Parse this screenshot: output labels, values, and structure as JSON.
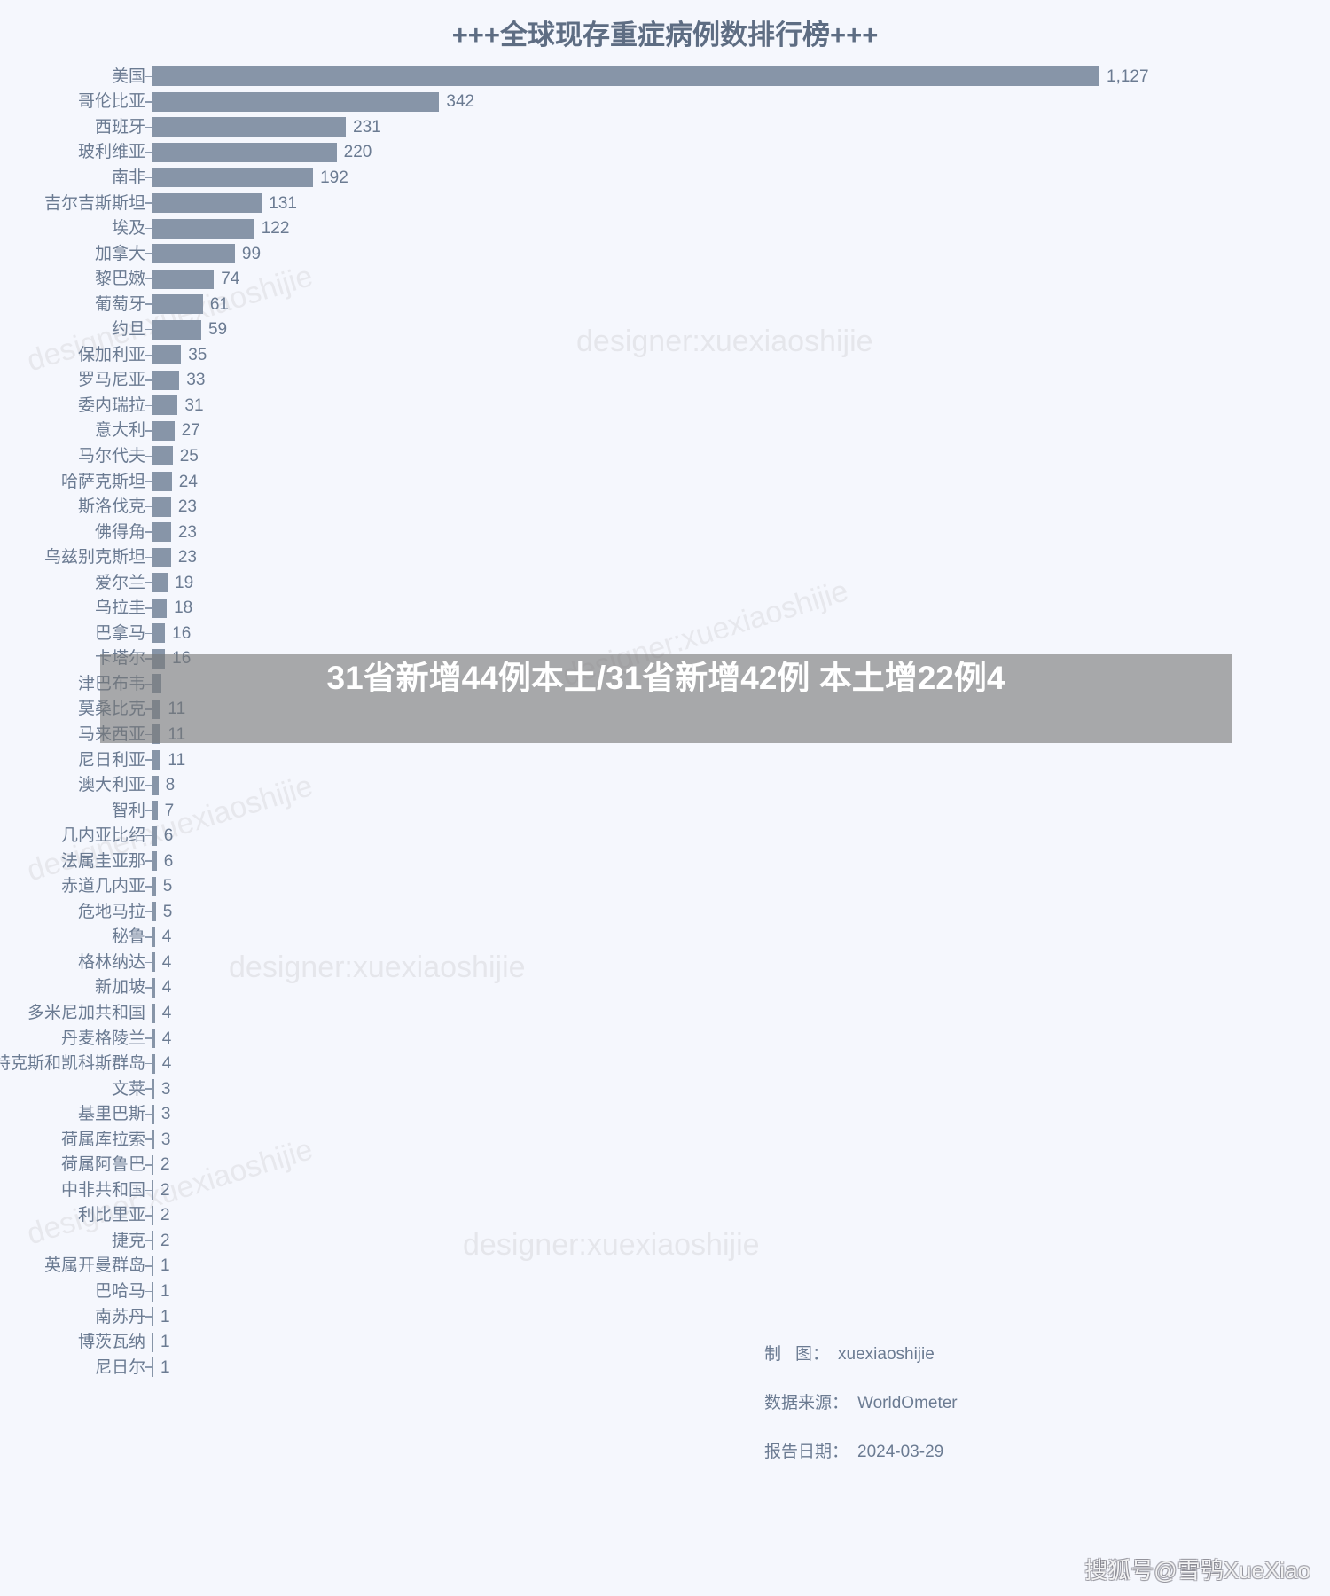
{
  "chart_data": {
    "type": "bar",
    "title": "+++全球现存重症病例数排行榜+++",
    "xlabel": "",
    "ylabel": "",
    "orientation": "horizontal",
    "grid": false,
    "legend": null,
    "xlim": [
      0,
      1127
    ],
    "bar_color": "#8795a8",
    "categories": [
      "美国",
      "哥伦比亚",
      "西班牙",
      "玻利维亚",
      "南非",
      "吉尔吉斯斯坦",
      "埃及",
      "加拿大",
      "黎巴嫩",
      "葡萄牙",
      "约旦",
      "保加利亚",
      "罗马尼亚",
      "委内瑞拉",
      "意大利",
      "马尔代夫",
      "哈萨克斯坦",
      "斯洛伐克",
      "佛得角",
      "乌兹别克斯坦",
      "爱尔兰",
      "乌拉圭",
      "巴拿马",
      "卡塔尔",
      "津巴布韦",
      "莫桑比克",
      "马来西亚",
      "尼日利亚",
      "澳大利亚",
      "智利",
      "几内亚比绍",
      "法属圭亚那",
      "赤道几内亚",
      "危地马拉",
      "秘鲁",
      "格林纳达",
      "新加坡",
      "多米尼加共和国",
      "丹麦格陵兰",
      "特克斯和凯科斯群岛",
      "文莱",
      "基里巴斯",
      "荷属库拉索",
      "荷属阿鲁巴",
      "中非共和国",
      "利比里亚",
      "捷克",
      "英属开曼群岛",
      "巴哈马",
      "南苏丹",
      "博茨瓦纳",
      "尼日尔"
    ],
    "values": [
      1127,
      342,
      231,
      220,
      192,
      131,
      122,
      99,
      74,
      61,
      59,
      35,
      33,
      31,
      27,
      25,
      24,
      23,
      23,
      23,
      19,
      18,
      16,
      16,
      12,
      11,
      11,
      11,
      8,
      7,
      6,
      6,
      5,
      5,
      4,
      4,
      4,
      4,
      4,
      4,
      3,
      3,
      3,
      2,
      2,
      2,
      2,
      1,
      1,
      1,
      1,
      1
    ],
    "value_labels": [
      "1,127",
      "342",
      "231",
      "220",
      "192",
      "131",
      "122",
      "99",
      "74",
      "61",
      "59",
      "35",
      "33",
      "31",
      "27",
      "25",
      "24",
      "23",
      "23",
      "23",
      "19",
      "18",
      "16",
      "16",
      "",
      "11",
      "11",
      "11",
      "8",
      "7",
      "6",
      "6",
      "5",
      "5",
      "4",
      "4",
      "4",
      "4",
      "4",
      "4",
      "3",
      "3",
      "3",
      "2",
      "2",
      "2",
      "2",
      "1",
      "1",
      "1",
      "1",
      "1"
    ]
  },
  "overlay": {
    "text": "31省新增44例本土/31省新增42例 本土增22例4",
    "background_color": "#787878"
  },
  "footer": {
    "designer_key": "制图：",
    "designer_key_left": "制",
    "designer_key_right": "图：",
    "designer_value": "xuexiaoshijie",
    "source_key": "数据来源：",
    "source_value": "WorldOmeter",
    "date_key": "报告日期：",
    "date_value": "2024-03-29"
  },
  "watermarks": {
    "text": "designer:xuexiaoshijie"
  },
  "branding": {
    "sohu_logo": "搜狐号@雪鸮XueXiao"
  }
}
